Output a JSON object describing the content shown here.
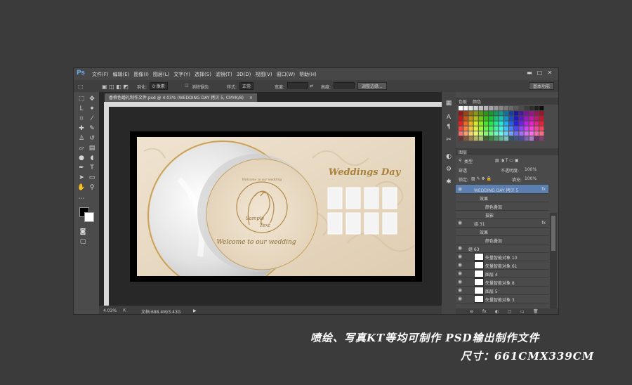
{
  "app": {
    "logo": "Ps",
    "menus": [
      "文件(F)",
      "编辑(E)",
      "图像(I)",
      "图层(L)",
      "文字(Y)",
      "选择(S)",
      "滤镜(T)",
      "3D(D)",
      "视图(V)",
      "窗口(W)",
      "帮助(H)"
    ],
    "window_controls": [
      "▬",
      "□",
      "✕"
    ]
  },
  "options_bar": {
    "feather_label": "羽化:",
    "feather_value": "0 像素",
    "antialias_label": "消除锯齿",
    "style_label": "样式:",
    "style_value": "正常",
    "width_label": "宽度:",
    "height_label": "高度:",
    "refine_button": "调整边缘...",
    "workspace": "基本功能"
  },
  "document": {
    "tab_title": "香槟色婚礼制作文件.psd @ 4.03% (WEDDING DAY 拷贝 5, CMYK/8)",
    "close": "×",
    "zoom": "4.03%",
    "doc_info": "文档:688.4M/3.43G"
  },
  "artwork": {
    "script_title": "Weddings Day",
    "names_line1": "Sample",
    "names_line2": "Text",
    "arc_text": "Welcome to our wedding",
    "welcome": "Welcome to our wedding",
    "colors": {
      "cream": "#e8d9c3",
      "gold": "#b8935a",
      "silver": "#d6d6d6"
    }
  },
  "panels": {
    "swatches_tab": "色板",
    "color_tab": "颜色",
    "layers_tab": "图层",
    "kind_filter": "类型",
    "blend_mode": "穿透",
    "opacity_label": "不透明度:",
    "opacity_value": "100%",
    "lock_label": "锁定:",
    "fill_label": "填充:",
    "fill_value": "100%",
    "layers": [
      {
        "name": "WEDDING DAY 拷贝 5",
        "indent": 1,
        "selected": true,
        "fx": "fx"
      },
      {
        "name": "效果",
        "indent": 2
      },
      {
        "name": "颜色叠加",
        "indent": 3
      },
      {
        "name": "投影",
        "indent": 3
      },
      {
        "name": "组 31",
        "indent": 1,
        "fx": "fx"
      },
      {
        "name": "效果",
        "indent": 2
      },
      {
        "name": "颜色叠加",
        "indent": 3
      },
      {
        "name": "组 63",
        "indent": 0
      },
      {
        "name": "矢量智能对象 10",
        "indent": 1,
        "thumb": true
      },
      {
        "name": "矢量智能对象 61",
        "indent": 1,
        "thumb": true
      },
      {
        "name": "图层 4",
        "indent": 1,
        "thumb": true
      },
      {
        "name": "矢量智能对象 8",
        "indent": 1,
        "thumb": true
      },
      {
        "name": "图层 5",
        "indent": 1,
        "thumb": true
      },
      {
        "name": "矢量智能对象 3",
        "indent": 1,
        "thumb": true
      }
    ],
    "bottom_icons": [
      "⊖",
      "fx",
      "◐",
      "▢",
      "▭",
      "🗑"
    ]
  },
  "caption": {
    "line1": "喷绘、写真KT等均可制作  PSD输出制作文件",
    "line2": "尺寸：661CMX339CM"
  }
}
